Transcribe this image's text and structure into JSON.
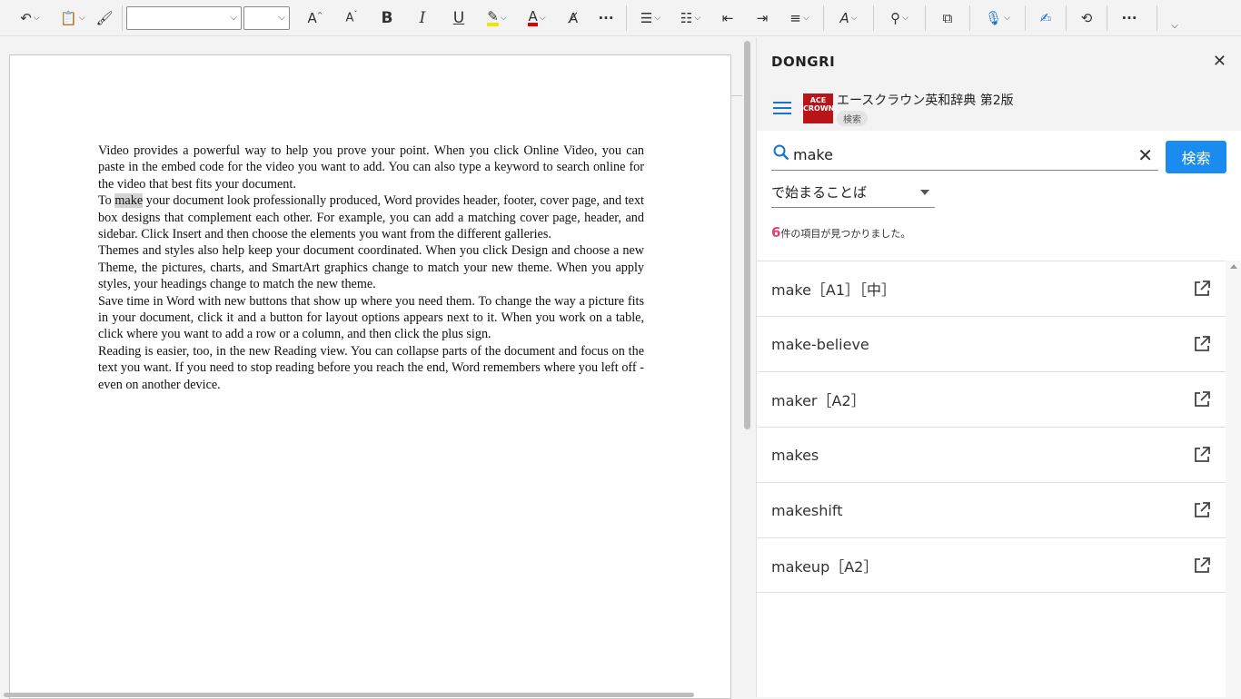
{
  "toolbar": {
    "font_name": "",
    "font_size": "",
    "bold": "B",
    "italic": "I",
    "underline": "U",
    "more": "···",
    "more2": "···"
  },
  "document": {
    "paragraphs": [
      {
        "before": "Video provides a powerful way to help you prove your point. When you click Online Video, you can paste in the embed code for the video you want to add. You can also type a keyword to search online for the video that best fits your document.",
        "highlight": "",
        "after": ""
      },
      {
        "before": "To ",
        "highlight": "make",
        "after": " your document look professionally produced, Word provides header, footer, cover page, and text box designs that complement each other. For example, you can add a matching cover page, header, and sidebar. Click Insert and then choose the elements you want from the different galleries."
      },
      {
        "before": "Themes and styles also help keep your document coordinated. When you click Design and choose a new Theme, the pictures, charts, and SmartArt graphics change to match your new theme. When you apply styles, your headings change to match the new theme.",
        "highlight": "",
        "after": ""
      },
      {
        "before": "Save time in Word with new buttons that show up where you need them. To change the way a picture fits in your document, click it and a button for layout options appears next to it. When you work on a table, click where you want to add a row or a column, and then click the plus sign.",
        "highlight": "",
        "after": ""
      },
      {
        "before": "Reading is easier, too, in the new Reading view. You can collapse parts of the document and focus on the text you want. If you need to stop reading before you reach the end, Word remembers where you left off - even on another device.",
        "highlight": "",
        "after": ""
      }
    ]
  },
  "panel": {
    "title": "DONGRI",
    "dictionary_name": "エースクラウン英和辞典 第2版",
    "dictionary_badge": "検索",
    "logo_text_1": "ACE",
    "logo_text_2": "CROWN",
    "search_value": "make",
    "search_button": "検索",
    "mode": "で始まることば",
    "result_count_number": "6",
    "result_count_text": "件の項目が見つかりました。",
    "results": [
      {
        "label": "make［A1］［中］"
      },
      {
        "label": "make-believe"
      },
      {
        "label": "maker［A2］"
      },
      {
        "label": "makes"
      },
      {
        "label": "makeshift"
      },
      {
        "label": "makeup［A2］"
      }
    ]
  },
  "colors": {
    "accent": "#1a8cf0",
    "count": "#e0427a",
    "logo": "#b8141a"
  }
}
